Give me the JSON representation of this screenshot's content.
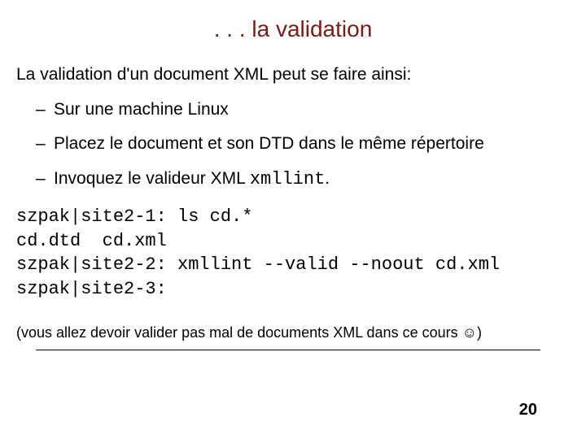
{
  "title": ". . . la validation",
  "intro": "La validation d'un document XML peut se faire ainsi:",
  "bullets": {
    "b1": "Sur une machine Linux",
    "b2": "Placez le document et son DTD dans le même répertoire",
    "b3_pre": "Invoquez le valideur XML ",
    "b3_cmd": "xmllint",
    "b3_post": "."
  },
  "code": "szpak|site2-1: ls cd.*\ncd.dtd  cd.xml\nszpak|site2-2: xmllint --valid --noout cd.xml\nszpak|site2-3:",
  "note_pre": "(vous allez devoir valider pas mal de documents XML dans ce cours ",
  "note_smiley": "☺",
  "note_post": ")",
  "pagenum": "20"
}
